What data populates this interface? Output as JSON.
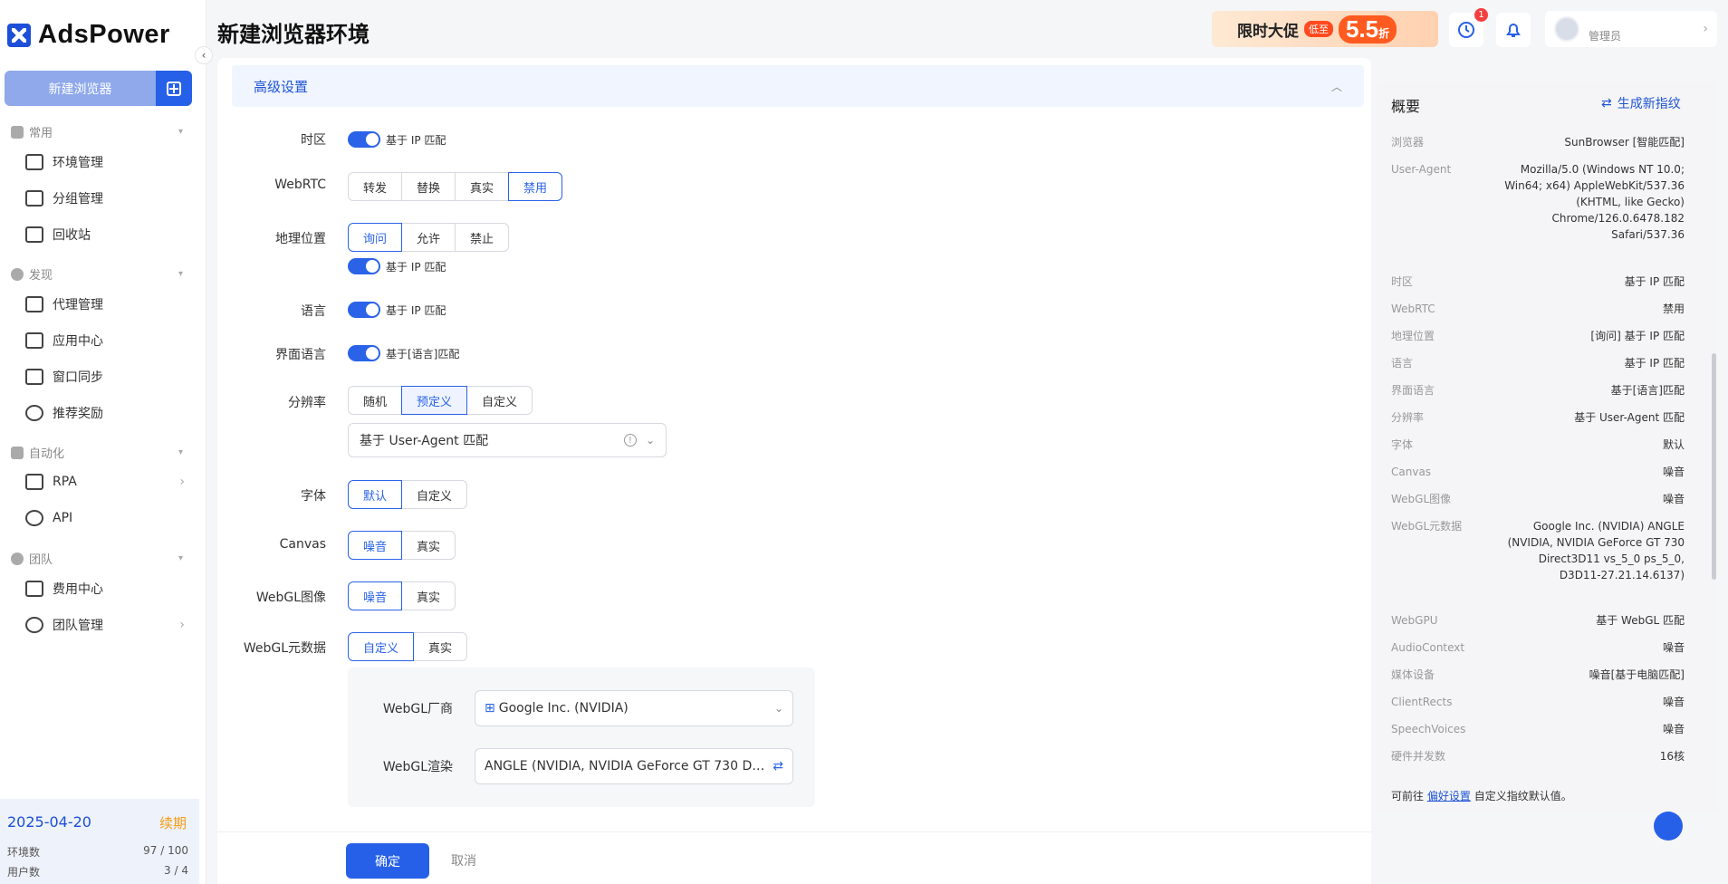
{
  "app": {
    "logo_text": "AdsPower",
    "page_title": "新建浏览器环境"
  },
  "sidebar": {
    "new_browser_label": "新建浏览器",
    "sections": [
      {
        "label": "常用",
        "items": [
          {
            "label": "环境管理"
          },
          {
            "label": "分组管理"
          },
          {
            "label": "回收站"
          }
        ]
      },
      {
        "label": "发现",
        "items": [
          {
            "label": "代理管理"
          },
          {
            "label": "应用中心"
          },
          {
            "label": "窗口同步"
          },
          {
            "label": "推荐奖励"
          }
        ]
      },
      {
        "label": "自动化",
        "items": [
          {
            "label": "RPA"
          },
          {
            "label": "API"
          }
        ]
      },
      {
        "label": "团队",
        "items": [
          {
            "label": "费用中心"
          },
          {
            "label": "团队管理"
          }
        ]
      }
    ],
    "footer": {
      "date": "2025-04-20",
      "renew": "续期",
      "env_label": "环境数",
      "env_value": "97 / 100",
      "user_label": "用户数",
      "user_value": "3 / 4"
    }
  },
  "header": {
    "promo": {
      "text": "限时大促",
      "tag": "低至",
      "value": "5.5",
      "unit": "折"
    },
    "notif_count": "1",
    "user_name": "管理员"
  },
  "advanced": {
    "section_title": "高级设置",
    "timezone": {
      "label": "时区",
      "toggle_text": "基于 IP 匹配"
    },
    "webrtc": {
      "label": "WebRTC",
      "options": [
        "转发",
        "替换",
        "真实",
        "禁用"
      ],
      "selected": "禁用"
    },
    "geo": {
      "label": "地理位置",
      "options": [
        "询问",
        "允许",
        "禁止"
      ],
      "selected": "询问",
      "toggle_text": "基于 IP 匹配"
    },
    "language": {
      "label": "语言",
      "toggle_text": "基于 IP 匹配"
    },
    "ui_language": {
      "label": "界面语言",
      "toggle_text": "基于[语言]匹配"
    },
    "resolution": {
      "label": "分辨率",
      "options": [
        "随机",
        "预定义",
        "自定义"
      ],
      "selected": "预定义",
      "select_value": "基于 User-Agent 匹配"
    },
    "font": {
      "label": "字体",
      "options": [
        "默认",
        "自定义"
      ],
      "selected": "默认"
    },
    "canvas": {
      "label": "Canvas",
      "options": [
        "噪音",
        "真实"
      ],
      "selected": "噪音"
    },
    "webgl_image": {
      "label": "WebGL图像",
      "options": [
        "噪音",
        "真实"
      ],
      "selected": "噪音"
    },
    "webgl_meta": {
      "label": "WebGL元数据",
      "options": [
        "自定义",
        "真实"
      ],
      "selected": "自定义",
      "vendor_label": "WebGL厂商",
      "vendor_value": "Google Inc. (NVIDIA)",
      "renderer_label": "WebGL渲染",
      "renderer_value": "ANGLE (NVIDIA, NVIDIA GeForce GT 730 Dir..."
    }
  },
  "actions": {
    "ok": "确定",
    "cancel": "取消"
  },
  "summary": {
    "title": "概要",
    "generate": "生成新指纹",
    "rows": [
      {
        "k": "浏览器",
        "v": "SunBrowser [智能匹配]"
      },
      {
        "k": "User-Agent",
        "v": "Mozilla/5.0 (Windows NT 10.0; Win64; x64) AppleWebKit/537.36 (KHTML, like Gecko) Chrome/126.0.6478.182 Safari/537.36"
      },
      {
        "k": "时区",
        "v": "基于 IP 匹配"
      },
      {
        "k": "WebRTC",
        "v": "禁用"
      },
      {
        "k": "地理位置",
        "v": "[询问] 基于 IP 匹配"
      },
      {
        "k": "语言",
        "v": "基于 IP 匹配"
      },
      {
        "k": "界面语言",
        "v": "基于[语言]匹配"
      },
      {
        "k": "分辨率",
        "v": "基于 User-Agent 匹配"
      },
      {
        "k": "字体",
        "v": "默认"
      },
      {
        "k": "Canvas",
        "v": "噪音"
      },
      {
        "k": "WebGL图像",
        "v": "噪音"
      },
      {
        "k": "WebGL元数据",
        "v": "Google Inc. (NVIDIA) ANGLE (NVIDIA, NVIDIA GeForce GT 730 Direct3D11 vs_5_0 ps_5_0, D3D11-27.21.14.6137)"
      },
      {
        "k": "WebGPU",
        "v": "基于 WebGL 匹配"
      },
      {
        "k": "AudioContext",
        "v": "噪音"
      },
      {
        "k": "媒体设备",
        "v": "噪音[基于电脑匹配]"
      },
      {
        "k": "ClientRects",
        "v": "噪音"
      },
      {
        "k": "SpeechVoices",
        "v": "噪音"
      },
      {
        "k": "硬件并发数",
        "v": "16核"
      }
    ],
    "footer_prefix": "可前往",
    "footer_link": "偏好设置",
    "footer_suffix": "自定义指纹默认值。"
  }
}
